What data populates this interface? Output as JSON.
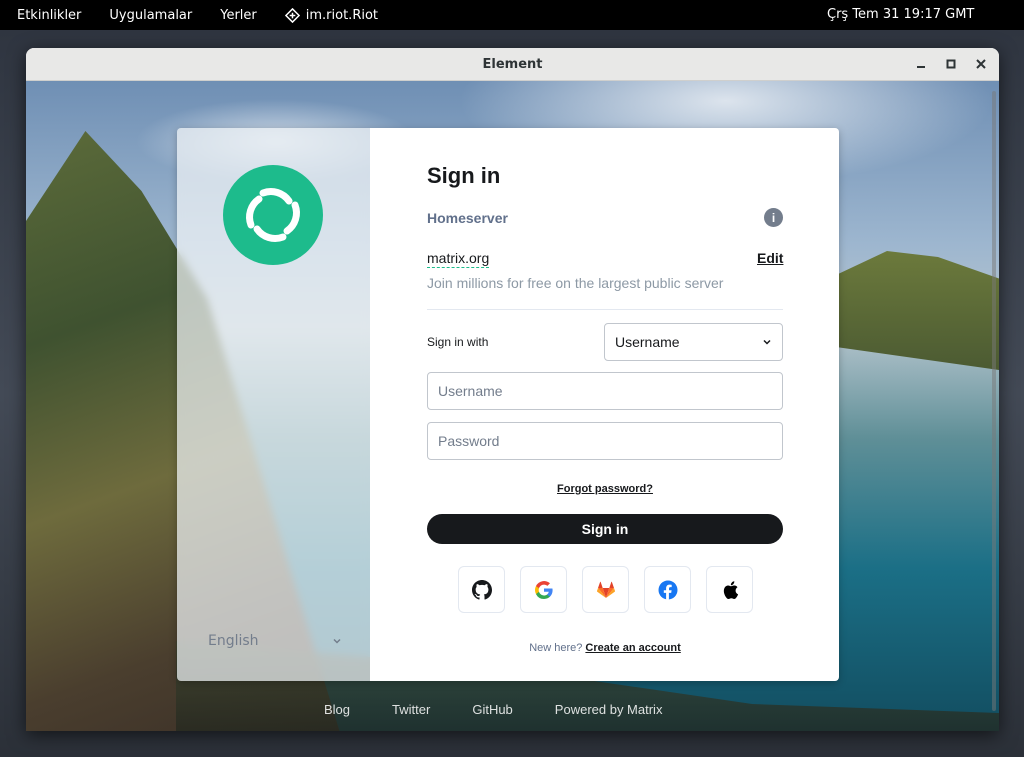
{
  "topbar": {
    "activities": "Etkinlikler",
    "applications": "Uygulamalar",
    "places": "Yerler",
    "app_name": "im.riot.Riot",
    "clock": "Çrş Tem 31  19:17 GMT"
  },
  "window": {
    "title": "Element"
  },
  "auth": {
    "heading": "Sign in",
    "homeserver_label": "Homeserver",
    "server_name": "matrix.org",
    "edit_label": "Edit",
    "server_description": "Join millions for free on the largest public server",
    "sign_in_with": "Sign in with",
    "login_type_selected": "Username",
    "username_placeholder": "Username",
    "password_placeholder": "Password",
    "forgot_password": "Forgot password?",
    "sign_in_button": "Sign in",
    "new_here": "New here?",
    "create_account": "Create an account",
    "sso_providers": [
      "github-icon",
      "google-icon",
      "gitlab-icon",
      "facebook-icon",
      "apple-icon"
    ],
    "language": "English"
  },
  "footer": {
    "blog": "Blog",
    "twitter": "Twitter",
    "github": "GitHub",
    "powered": "Powered by Matrix"
  },
  "colors": {
    "brand_green": "#1dbb8c",
    "primary_button": "#17191c",
    "text_muted": "#8d99a5"
  }
}
